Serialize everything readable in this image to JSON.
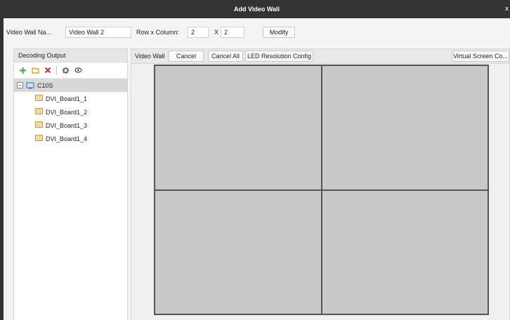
{
  "window": {
    "title": "Add Video Wall",
    "close_glyph": "x"
  },
  "form": {
    "name_label": "Video Wall Na...",
    "name_value": "Video Wall 2",
    "rowcol_label": "Row x Column:",
    "rows_value": "2",
    "x_label": "X",
    "cols_value": "2",
    "modify_label": "Modify"
  },
  "left_panel": {
    "header": "Decoding Output",
    "toolbar_icons": [
      "add-icon",
      "folder-icon",
      "delete-icon",
      "settings-icon",
      "view-icon"
    ],
    "root": {
      "label": "C10S",
      "expander": "−"
    },
    "outputs": [
      {
        "label": "DVI_Board1_1"
      },
      {
        "label": "DVI_Board1_2"
      },
      {
        "label": "DVI_Board1_3"
      },
      {
        "label": "DVI_Board1_4"
      }
    ]
  },
  "right_panel": {
    "wall_label": "Video Wall",
    "cancel_label": "Cancel",
    "cancel_all_label": "Cancel All",
    "led_label": "LED Resolution Config",
    "virtual_label": "Virtual Screen Co...",
    "rows": 2,
    "cols": 2
  },
  "colors": {
    "titlebar": "#333333",
    "add_green": "#3aa83a",
    "folder_orange": "#e9a21c",
    "delete_red": "#d62828",
    "grid_fill": "#c8c8c8"
  }
}
